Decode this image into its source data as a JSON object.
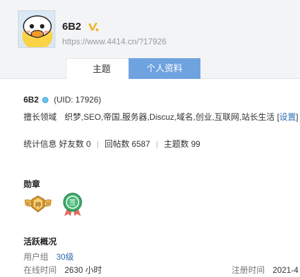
{
  "profile": {
    "username": "6B2",
    "url": "https://www.4414.cn/?17926"
  },
  "tabs": [
    {
      "label": "主题",
      "active": false
    },
    {
      "label": "个人资料",
      "active": true
    }
  ],
  "info": {
    "name": "6B2",
    "uid": "(UID: 17926)",
    "expertise_label": "擅长领域",
    "expertise_value": "织梦,SEO,帝国,服务器,Discuz,域名,创业,互联网,站长生活",
    "set_link_open": "[",
    "set_link_label": "设置",
    "set_link_close": "]",
    "stats_label": "统计信息",
    "friends": "好友数 0",
    "replies": "回帖数 6587",
    "topics": "主题数 99"
  },
  "medals": {
    "title": "勋章",
    "items": [
      {
        "glyph": "神"
      },
      {
        "glyph": "签"
      }
    ]
  },
  "activity": {
    "title": "活跃概况",
    "group_label": "用户组",
    "group_value": "30级",
    "online_label": "在线时间",
    "online_value": "2630 小时",
    "reg_label": "注册时间",
    "reg_value": "2021-4"
  },
  "colors": {
    "tab_active": "#6fa3e0",
    "link": "#2b6cb0",
    "header_bg": "#f3f4f6"
  }
}
